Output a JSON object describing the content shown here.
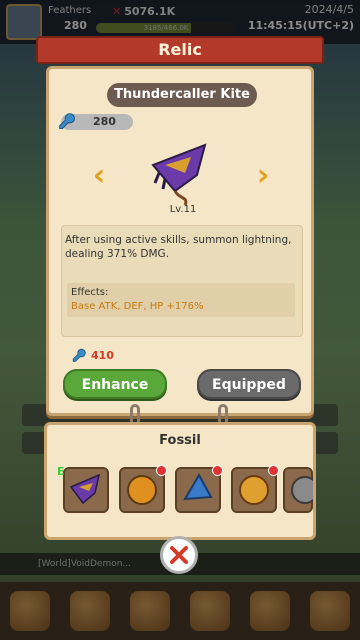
{
  "hud": {
    "player_name": "Feathers",
    "player_level": "280",
    "power": "5076.1K",
    "exp_text": "3185/466.0K",
    "exp_fraction": 0.68,
    "date": "2024/4/5",
    "time": "11:45:15(UTC+2)"
  },
  "banner": {
    "title": "Relic"
  },
  "relic": {
    "name": "Thundercaller Kite",
    "owned_count": "280",
    "level": "Lv.11",
    "description": "After using active skills, summon lightning, dealing 371% DMG.",
    "effects_label": "Effects:",
    "effects_value": "Base ATK, DEF, HP +176%",
    "enhance_cost": "410"
  },
  "buttons": {
    "enhance": "Enhance",
    "equipped": "Equipped"
  },
  "fossil": {
    "title": "Fossil",
    "slots": [
      {
        "name": "thundercaller-kite",
        "equipped": true,
        "badge": false
      },
      {
        "name": "fossil-relic-2",
        "equipped": false,
        "badge": true
      },
      {
        "name": "fossil-relic-3",
        "equipped": false,
        "badge": true
      },
      {
        "name": "fossil-relic-4",
        "equipped": false,
        "badge": true
      },
      {
        "name": "fossil-relic-5",
        "equipped": false,
        "badge": false
      }
    ],
    "equipped_marker": "E"
  },
  "chat": {
    "text": "[World]VoidDemon..."
  },
  "colors": {
    "banner_red": "#b33a2a",
    "enhance_green": "#5aa83a",
    "equipped_gray": "#6a6a6a",
    "effects_orange": "#c87a10",
    "cost_red": "#d23a2a",
    "arrow_gold": "#e0a020"
  },
  "icons": {
    "wrench": "wrench-icon",
    "left_arrow": "chevron-left-icon",
    "right_arrow": "chevron-right-icon",
    "close": "close-icon"
  }
}
